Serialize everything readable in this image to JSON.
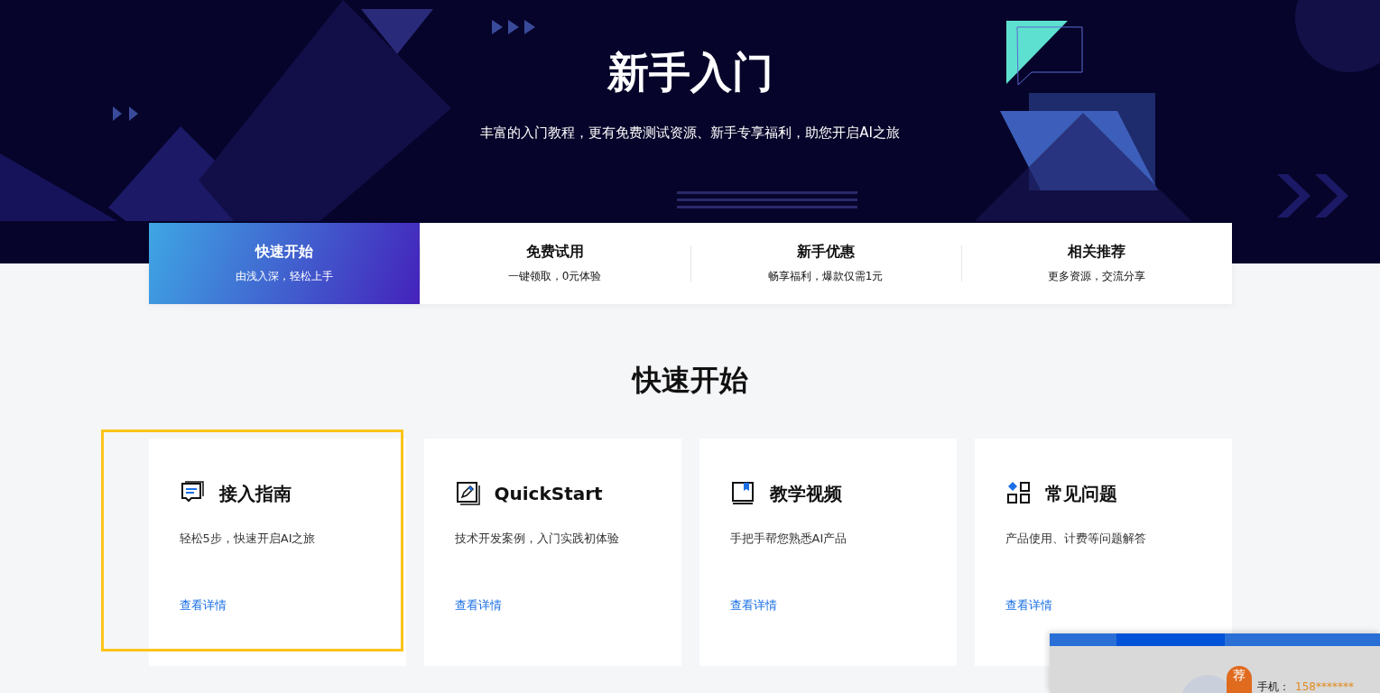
{
  "hero": {
    "title": "新手入门",
    "subtitle": "丰富的入门教程，更有免费测试资源、新手专享福利，助您开启AI之旅"
  },
  "tabs": [
    {
      "title": "快速开始",
      "subtitle": "由浅入深，轻松上手",
      "selected": true
    },
    {
      "title": "免费试用",
      "subtitle": "一键领取，0元体验",
      "selected": false
    },
    {
      "title": "新手优惠",
      "subtitle": "畅享福利，爆款仅需1元",
      "selected": false
    },
    {
      "title": "相关推荐",
      "subtitle": "更多资源，交流分享",
      "selected": false
    }
  ],
  "section": {
    "heading": "快速开始",
    "cards": [
      {
        "kind": "guide",
        "title": "接入指南",
        "description": "轻松5步，快速开启AI之旅",
        "link": "查看详情",
        "highlighted": true
      },
      {
        "kind": "edit",
        "title": "QuickStart",
        "description": "技术开发案例，入门实践初体验",
        "link": "查看详情",
        "highlighted": false
      },
      {
        "kind": "video",
        "title": "教学视频",
        "description": "手把手帮您熟悉AI产品",
        "link": "查看详情",
        "highlighted": false
      },
      {
        "kind": "faq",
        "title": "常见问题",
        "description": "产品使用、计费等问题解答",
        "link": "查看详情",
        "highlighted": false
      }
    ]
  },
  "popup": {
    "badge": "荐",
    "label": "手机：",
    "value": "158*******"
  }
}
